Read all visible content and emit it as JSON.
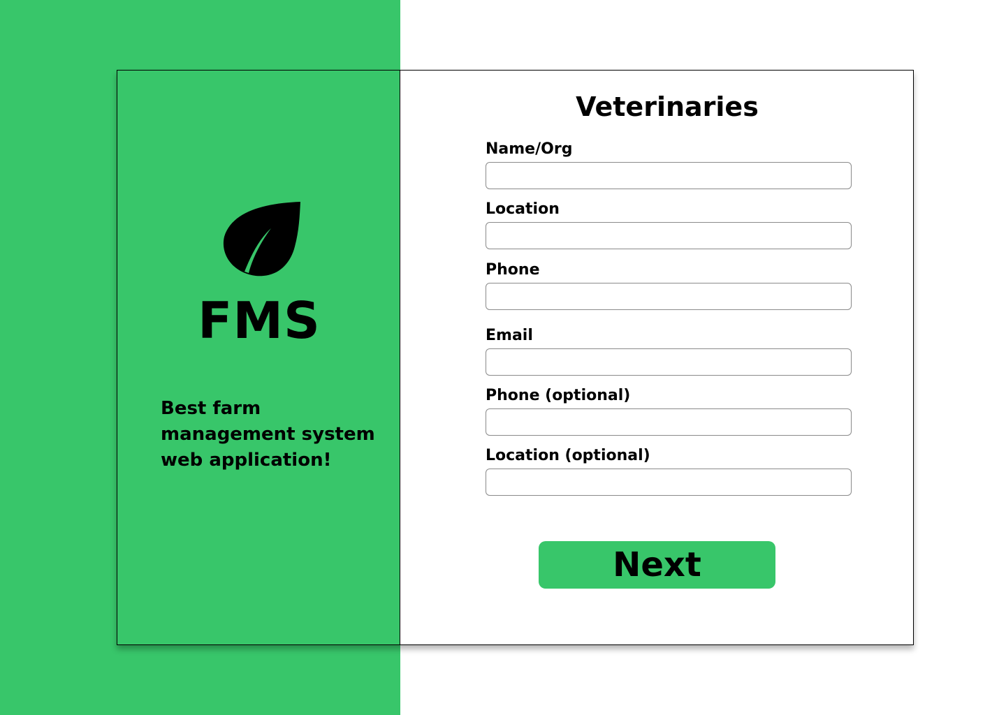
{
  "brand": {
    "logo_icon": "leaf-icon",
    "name": "FMS",
    "tagline_lines": [
      "Best farm",
      "management system",
      "web application!"
    ]
  },
  "form": {
    "title": "Veterinaries",
    "fields": [
      {
        "label": "Name/Org",
        "value": "",
        "placeholder": ""
      },
      {
        "label": "Location",
        "value": "",
        "placeholder": ""
      },
      {
        "label": "Phone",
        "value": "",
        "placeholder": ""
      },
      {
        "label": "Email",
        "value": "",
        "placeholder": ""
      },
      {
        "label": "Phone (optional)",
        "value": "",
        "placeholder": ""
      },
      {
        "label": "Location (optional)",
        "value": "",
        "placeholder": ""
      }
    ],
    "submit_label": "Next"
  },
  "colors": {
    "accent": "#38c66a",
    "text": "#000000",
    "background": "#ffffff"
  }
}
